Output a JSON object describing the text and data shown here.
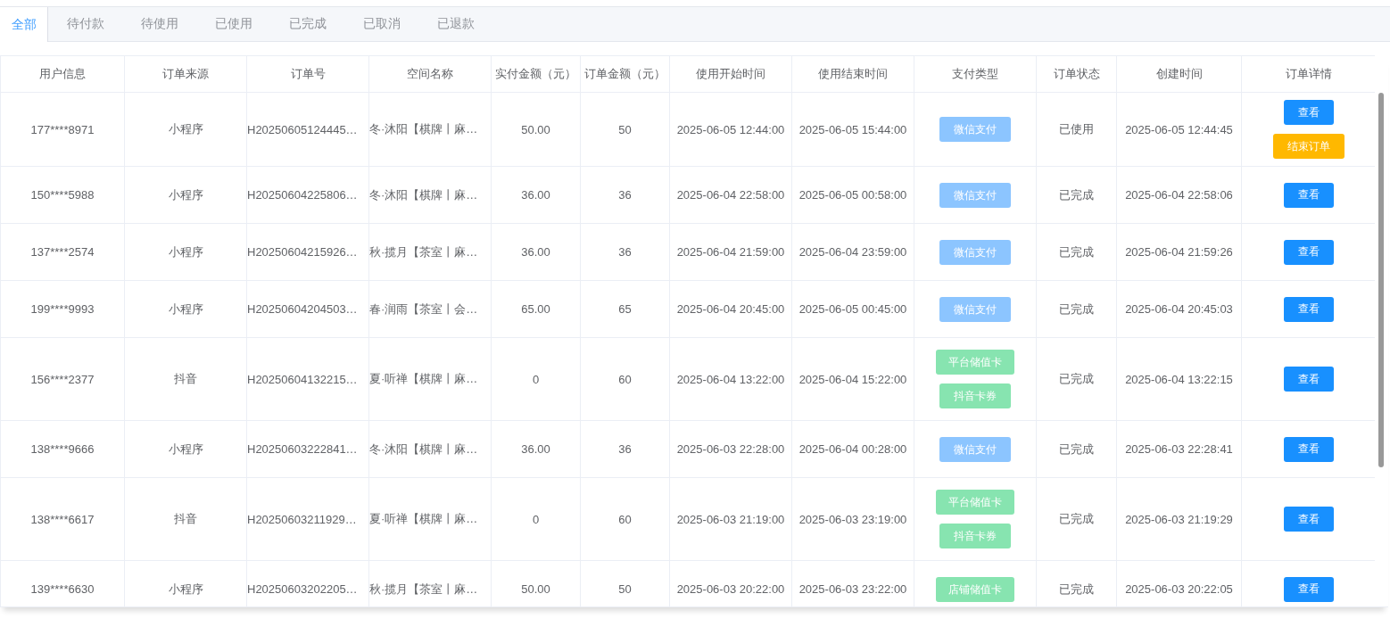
{
  "tabs": [
    {
      "label": "全部",
      "selected": true
    },
    {
      "label": "待付款",
      "selected": false
    },
    {
      "label": "待使用",
      "selected": false
    },
    {
      "label": "已使用",
      "selected": false
    },
    {
      "label": "已完成",
      "selected": false
    },
    {
      "label": "已取消",
      "selected": false
    },
    {
      "label": "已退款",
      "selected": false
    }
  ],
  "table": {
    "columns": [
      "用户信息",
      "订单来源",
      "订单号",
      "空间名称",
      "实付金额（元）",
      "订单金额（元）",
      "使用开始时间",
      "使用结束时间",
      "支付类型",
      "订单状态",
      "创建时间",
      "订单详情"
    ],
    "rows": [
      {
        "user": "177****8971",
        "source": "小程序",
        "order_no": "H20250605124445…",
        "space": "冬·沐阳【棋牌丨麻…",
        "paid": "50.00",
        "amount": "50",
        "start": "2025-06-05 12:44:00",
        "end": "2025-06-05 15:44:00",
        "payments": [
          {
            "kind": "wechat",
            "label": "微信支付"
          }
        ],
        "status": "已使用",
        "created": "2025-06-05 12:44:45",
        "actions": [
          {
            "kind": "view",
            "label": "查看"
          },
          {
            "kind": "end",
            "label": "结束订单"
          }
        ]
      },
      {
        "user": "150****5988",
        "source": "小程序",
        "order_no": "H20250604225806…",
        "space": "冬·沐阳【棋牌丨麻…",
        "paid": "36.00",
        "amount": "36",
        "start": "2025-06-04 22:58:00",
        "end": "2025-06-05 00:58:00",
        "payments": [
          {
            "kind": "wechat",
            "label": "微信支付"
          }
        ],
        "status": "已完成",
        "created": "2025-06-04 22:58:06",
        "actions": [
          {
            "kind": "view",
            "label": "查看"
          }
        ]
      },
      {
        "user": "137****2574",
        "source": "小程序",
        "order_no": "H20250604215926…",
        "space": "秋·揽月【茶室丨麻…",
        "paid": "36.00",
        "amount": "36",
        "start": "2025-06-04 21:59:00",
        "end": "2025-06-04 23:59:00",
        "payments": [
          {
            "kind": "wechat",
            "label": "微信支付"
          }
        ],
        "status": "已完成",
        "created": "2025-06-04 21:59:26",
        "actions": [
          {
            "kind": "view",
            "label": "查看"
          }
        ]
      },
      {
        "user": "199****9993",
        "source": "小程序",
        "order_no": "H20250604204503…",
        "space": "春·润雨【茶室丨会…",
        "paid": "65.00",
        "amount": "65",
        "start": "2025-06-04 20:45:00",
        "end": "2025-06-05 00:45:00",
        "payments": [
          {
            "kind": "wechat",
            "label": "微信支付"
          }
        ],
        "status": "已完成",
        "created": "2025-06-04 20:45:03",
        "actions": [
          {
            "kind": "view",
            "label": "查看"
          }
        ]
      },
      {
        "user": "156****2377",
        "source": "抖音",
        "order_no": "H20250604132215…",
        "space": "夏·听禅【棋牌丨麻…",
        "paid": "0",
        "amount": "60",
        "start": "2025-06-04 13:22:00",
        "end": "2025-06-04 15:22:00",
        "payments": [
          {
            "kind": "platform_card",
            "label": "平台储值卡"
          },
          {
            "kind": "douyin_coupon",
            "label": "抖音卡券"
          }
        ],
        "status": "已完成",
        "created": "2025-06-04 13:22:15",
        "actions": [
          {
            "kind": "view",
            "label": "查看"
          }
        ]
      },
      {
        "user": "138****9666",
        "source": "小程序",
        "order_no": "H20250603222841…",
        "space": "冬·沐阳【棋牌丨麻…",
        "paid": "36.00",
        "amount": "36",
        "start": "2025-06-03 22:28:00",
        "end": "2025-06-04 00:28:00",
        "payments": [
          {
            "kind": "wechat",
            "label": "微信支付"
          }
        ],
        "status": "已完成",
        "created": "2025-06-03 22:28:41",
        "actions": [
          {
            "kind": "view",
            "label": "查看"
          }
        ]
      },
      {
        "user": "138****6617",
        "source": "抖音",
        "order_no": "H20250603211929…",
        "space": "夏·听禅【棋牌丨麻…",
        "paid": "0",
        "amount": "60",
        "start": "2025-06-03 21:19:00",
        "end": "2025-06-03 23:19:00",
        "payments": [
          {
            "kind": "platform_card",
            "label": "平台储值卡"
          },
          {
            "kind": "douyin_coupon",
            "label": "抖音卡券"
          }
        ],
        "status": "已完成",
        "created": "2025-06-03 21:19:29",
        "actions": [
          {
            "kind": "view",
            "label": "查看"
          }
        ]
      },
      {
        "user": "139****6630",
        "source": "小程序",
        "order_no": "H20250603202205…",
        "space": "秋·揽月【茶室丨麻…",
        "paid": "50.00",
        "amount": "50",
        "start": "2025-06-03 20:22:00",
        "end": "2025-06-03 23:22:00",
        "payments": [
          {
            "kind": "store_card",
            "label": "店铺储值卡"
          }
        ],
        "status": "已完成",
        "created": "2025-06-03 20:22:05",
        "actions": [
          {
            "kind": "view",
            "label": "查看"
          }
        ]
      }
    ]
  }
}
